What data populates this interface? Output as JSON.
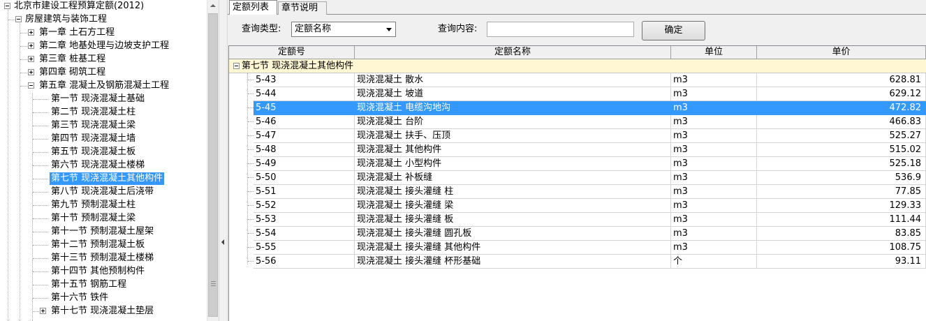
{
  "tree": {
    "root": "北京市建设工程预算定额(2012)",
    "category": "房屋建筑与装饰工程",
    "chapters": [
      "第一章 土石方工程",
      "第二章 地基处理与边坡支护工程",
      "第三章 桩基工程",
      "第四章 砌筑工程",
      "第五章 混凝土及钢筋混凝土工程"
    ],
    "sections": [
      "第一节 现浇混凝土基础",
      "第二节 现浇混凝土柱",
      "第三节 现浇混凝土梁",
      "第四节 现浇混凝土墙",
      "第五节 现浇混凝土板",
      "第六节 现浇混凝土楼梯",
      "第七节 现浇混凝土其他构件",
      "第八节 现浇混凝土后浇带",
      "第九节 预制混凝土柱",
      "第十节 预制混凝土梁",
      "第十一节 预制混凝土屋架",
      "第十二节 预制混凝土板",
      "第十三节 预制混凝土楼梯",
      "第十四节 其他预制构件",
      "第十五节 钢筋工程",
      "第十六节 铁件",
      "第十七节 现浇混凝土垫层"
    ],
    "selected_section": "第七节 现浇混凝土其他构件"
  },
  "tabs": [
    "定额列表",
    "章节说明"
  ],
  "query": {
    "type_label": "查询类型:",
    "type_value": "定额名称",
    "content_label": "查询内容:",
    "content_value": "",
    "ok_label": "确定"
  },
  "grid": {
    "headers": [
      "定额号",
      "定额名称",
      "单位",
      "单价"
    ],
    "group": "第七节 现浇混凝土其他构件",
    "selected_code": "5-45",
    "rows": [
      {
        "code": "5-43",
        "name": "现浇混凝土 散水",
        "unit": "m3",
        "price": "628.81"
      },
      {
        "code": "5-44",
        "name": "现浇混凝土 坡道",
        "unit": "m3",
        "price": "629.12"
      },
      {
        "code": "5-45",
        "name": "现浇混凝土 电缆沟地沟",
        "unit": "m3",
        "price": "472.82"
      },
      {
        "code": "5-46",
        "name": "现浇混凝土 台阶",
        "unit": "m3",
        "price": "466.83"
      },
      {
        "code": "5-47",
        "name": "现浇混凝土 扶手、压顶",
        "unit": "m3",
        "price": "525.27"
      },
      {
        "code": "5-48",
        "name": "现浇混凝土 其他构件",
        "unit": "m3",
        "price": "515.02"
      },
      {
        "code": "5-49",
        "name": "现浇混凝土 小型构件",
        "unit": "m3",
        "price": "525.18"
      },
      {
        "code": "5-50",
        "name": "现浇混凝土 补板缝",
        "unit": "m3",
        "price": "536.9"
      },
      {
        "code": "5-51",
        "name": "现浇混凝土 接头灌缝 柱",
        "unit": "m3",
        "price": "77.85"
      },
      {
        "code": "5-52",
        "name": "现浇混凝土 接头灌缝 梁",
        "unit": "m3",
        "price": "129.33"
      },
      {
        "code": "5-53",
        "name": "现浇混凝土 接头灌缝 板",
        "unit": "m3",
        "price": "111.44"
      },
      {
        "code": "5-54",
        "name": "现浇混凝土 接头灌缝 圆孔板",
        "unit": "m3",
        "price": "83.85"
      },
      {
        "code": "5-55",
        "name": "现浇混凝土 接头灌缝 其他构件",
        "unit": "m3",
        "price": "108.75"
      },
      {
        "code": "5-56",
        "name": "现浇混凝土 接头灌缝 杯形基础",
        "unit": "个",
        "price": "93.11"
      }
    ]
  },
  "colors": {
    "selection": "#3399ff",
    "group_row": "#fff7d4"
  }
}
